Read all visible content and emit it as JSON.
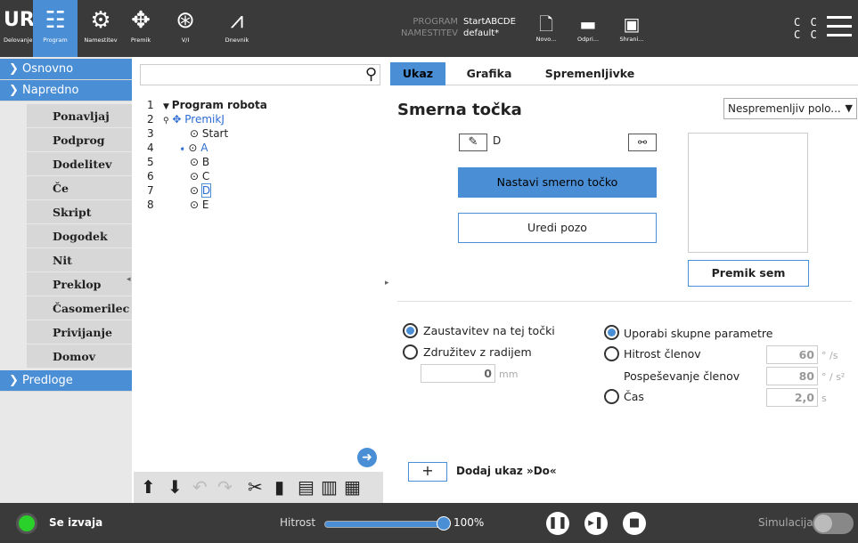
{
  "topbar": {
    "tabs": [
      {
        "label": "Delovanje",
        "icon": "ur-logo-icon"
      },
      {
        "label": "Program",
        "icon": "program-icon"
      },
      {
        "label": "Namestitev",
        "icon": "installation-icon"
      },
      {
        "label": "Premik",
        "icon": "move-icon"
      },
      {
        "label": "V/I",
        "icon": "io-icon"
      },
      {
        "label": "Dnevnik",
        "icon": "log-icon"
      }
    ],
    "program_key": "PROGRAM",
    "program_value": "StartABCDE",
    "installation_key": "NAMESTITEV",
    "installation_value": "default*",
    "file_buttons": [
      {
        "label": "Novo...",
        "icon": "new-file-icon"
      },
      {
        "label": "Odpri...",
        "icon": "open-folder-icon"
      },
      {
        "label": "Shrani...",
        "icon": "save-icon"
      }
    ],
    "cc_top": "C C",
    "cc_bottom": "C C"
  },
  "leftnav": {
    "sections": [
      {
        "label": "Osnovno"
      },
      {
        "label": "Napredno"
      },
      {
        "label": "Predloge"
      }
    ],
    "items": [
      "Ponavljaj",
      "Podprog",
      "Dodelitev",
      "Če",
      "Skript",
      "Dogodek",
      "Nit",
      "Preklop",
      "Časomerilec",
      "Privijanje",
      "Domov"
    ]
  },
  "tree": {
    "rows": [
      {
        "num": "1",
        "label": "Program robota"
      },
      {
        "num": "2",
        "label": "PremikJ"
      },
      {
        "num": "3",
        "label": "Start"
      },
      {
        "num": "4",
        "label": "A"
      },
      {
        "num": "5",
        "label": "B"
      },
      {
        "num": "6",
        "label": "C"
      },
      {
        "num": "7",
        "label": "D"
      },
      {
        "num": "8",
        "label": "E"
      }
    ]
  },
  "tabs": [
    "Ukaz",
    "Grafika",
    "Spremenljivke"
  ],
  "command": {
    "title": "Smerna točka",
    "dropdown_value": "Nespremenljiv polo...",
    "waypoint_name": "D",
    "set_button": "Nastavi smerno točko",
    "edit_button": "Uredi pozo",
    "move_button": "Premik sem",
    "opt_stop": "Zaustavitev na tej točki",
    "opt_blend": "Združitev z radijem",
    "blend_value": "0",
    "blend_unit": "mm",
    "opt_shared": "Uporabi skupne parametre",
    "opt_speed": "Hitrost členov",
    "speed_value": "60",
    "speed_unit": "° /s",
    "accel_label": "Pospeševanje členov",
    "accel_value": "80",
    "accel_unit": "° / s²",
    "opt_time": "Čas",
    "time_value": "2,0",
    "time_unit": "s",
    "add_button": "+",
    "add_label": "Dodaj ukaz »Do«"
  },
  "footer": {
    "status": "Se izvaja",
    "speed_label": "Hitrost",
    "speed_value": "100%",
    "speed_fraction": 1.0,
    "sim_label": "Simulacija"
  }
}
